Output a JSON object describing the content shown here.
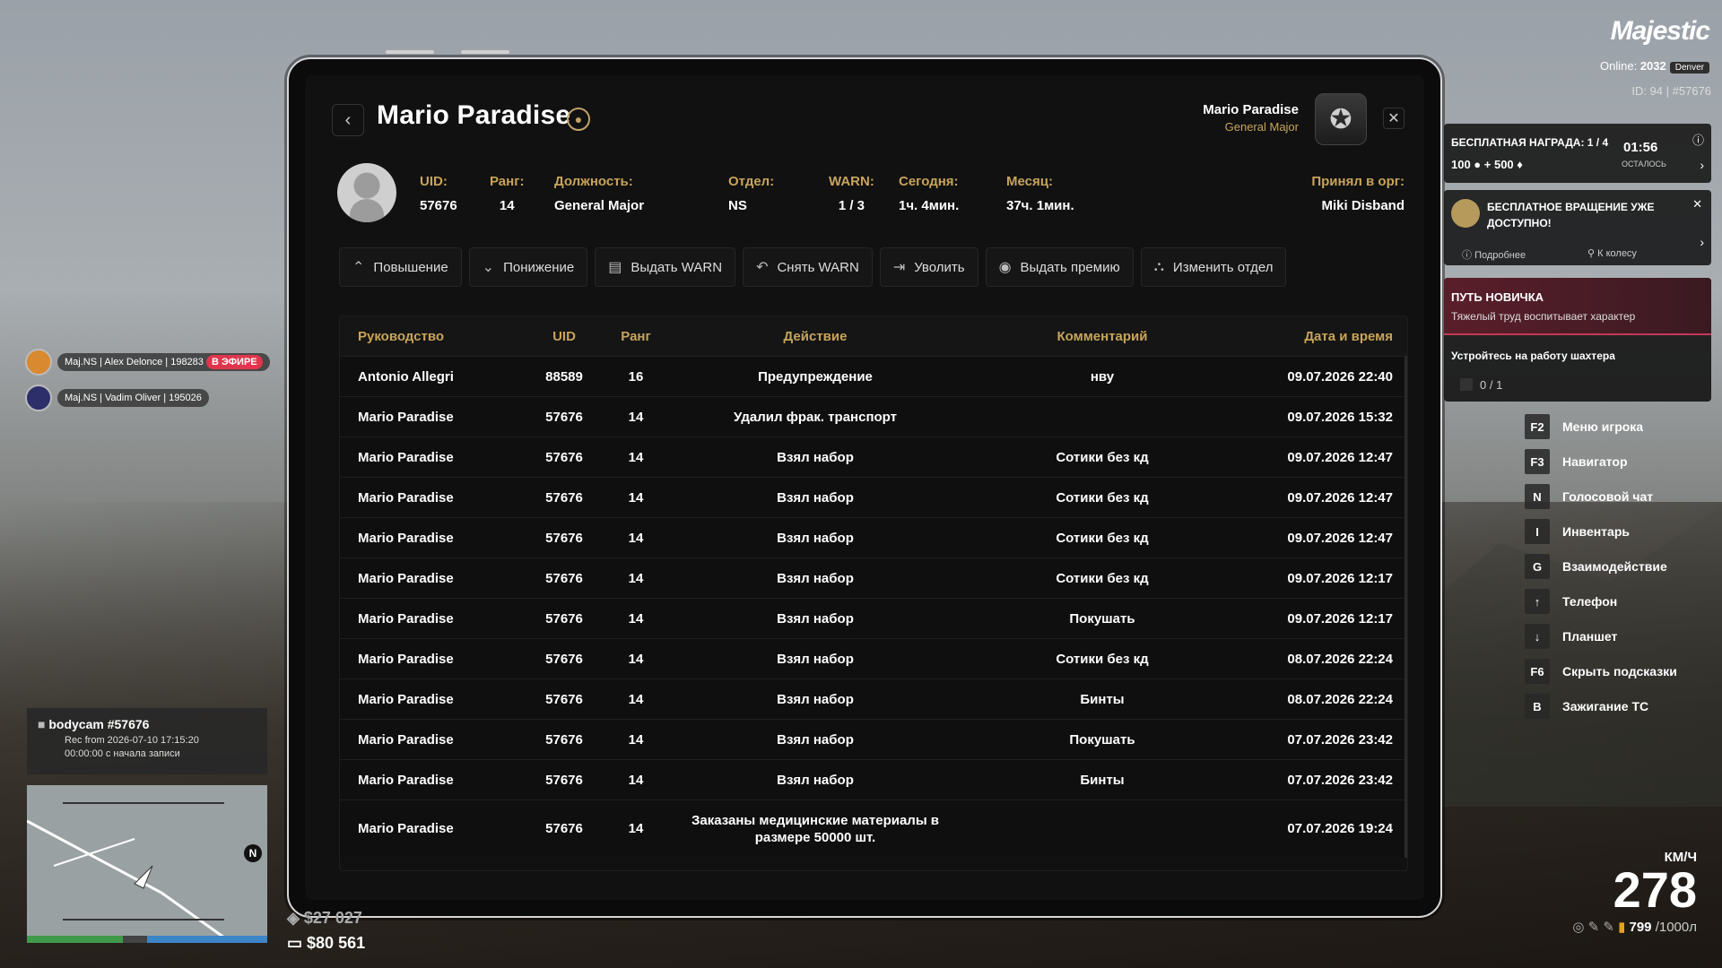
{
  "tablet": {
    "title": "Mario Paradise",
    "user_name": "Mario Paradise",
    "user_rank": "General Major",
    "info": [
      {
        "label": "UID:",
        "value": "57676"
      },
      {
        "label": "Ранг:",
        "value": "14"
      },
      {
        "label": "Должность:",
        "value": "General Major"
      },
      {
        "label": "Отдел:",
        "value": "NS"
      },
      {
        "label": "WARN:",
        "value": "1 / 3"
      },
      {
        "label": "Сегодня:",
        "value": "1ч. 4мин."
      },
      {
        "label": "Месяц:",
        "value": "37ч. 1мин."
      },
      {
        "label": "Принял в орг:",
        "value": "Miki Disband"
      }
    ],
    "actions": [
      {
        "label": "Повышение",
        "icon": "chevron-up-icon"
      },
      {
        "label": "Понижение",
        "icon": "chevron-down-icon"
      },
      {
        "label": "Выдать WARN",
        "icon": "document-icon"
      },
      {
        "label": "Снять WARN",
        "icon": "undo-icon"
      },
      {
        "label": "Уволить",
        "icon": "person-exit-icon"
      },
      {
        "label": "Выдать премию",
        "icon": "coin-icon"
      },
      {
        "label": "Изменить отдел",
        "icon": "hierarchy-icon"
      }
    ],
    "table": {
      "headers": [
        "Руководство",
        "UID",
        "Ранг",
        "Действие",
        "Комментарий",
        "Дата и время"
      ],
      "rows": [
        [
          "Antonio Allegri",
          "88589",
          "16",
          "Предупреждение",
          "нву",
          "09.07.2026 22:40"
        ],
        [
          "Mario Paradise",
          "57676",
          "14",
          "Удалил фрак. транспорт",
          "",
          "09.07.2026 15:32"
        ],
        [
          "Mario Paradise",
          "57676",
          "14",
          "Взял набор",
          "Сотики без кд",
          "09.07.2026 12:47"
        ],
        [
          "Mario Paradise",
          "57676",
          "14",
          "Взял набор",
          "Сотики без кд",
          "09.07.2026 12:47"
        ],
        [
          "Mario Paradise",
          "57676",
          "14",
          "Взял набор",
          "Сотики без кд",
          "09.07.2026 12:47"
        ],
        [
          "Mario Paradise",
          "57676",
          "14",
          "Взял набор",
          "Сотики без кд",
          "09.07.2026 12:17"
        ],
        [
          "Mario Paradise",
          "57676",
          "14",
          "Взял набор",
          "Покушать",
          "09.07.2026 12:17"
        ],
        [
          "Mario Paradise",
          "57676",
          "14",
          "Взял набор",
          "Сотики без кд",
          "08.07.2026 22:24"
        ],
        [
          "Mario Paradise",
          "57676",
          "14",
          "Взял набор",
          "Бинты",
          "08.07.2026 22:24"
        ],
        [
          "Mario Paradise",
          "57676",
          "14",
          "Взял набор",
          "Покушать",
          "07.07.2026 23:42"
        ],
        [
          "Mario Paradise",
          "57676",
          "14",
          "Взял набор",
          "Бинты",
          "07.07.2026 23:42"
        ],
        [
          "Mario Paradise",
          "57676",
          "14",
          "Заказаны медицинские материалы в размере 50000 шт.",
          "",
          "07.07.2026 19:24"
        ]
      ]
    }
  },
  "hud": {
    "logo": "Majestic",
    "online_label": "Online:",
    "online_count": "2032",
    "server": "Denver",
    "id_text": "ID: 94 | #57676",
    "reward_title": "БЕСПЛАТНАЯ НАГРАДА: 1 / 4",
    "reward_values": "100 ● + 500 ♦",
    "reward_time": "01:56",
    "reward_time_label": "ОСТАЛОСЬ",
    "spin_title": "БЕСПЛАТНОЕ ВРАЩЕНИЕ УЖЕ ДОСТУПНО!",
    "spin_more": "Подробнее",
    "spin_wheel": "К колесу",
    "quest_title": "ПУТЬ НОВИЧКА",
    "quest_sub": "Тяжелый труд воспитывает характер",
    "quest_task": "Устройтесь на работу шахтера",
    "quest_progress": "0 / 1",
    "keys": [
      {
        "key": "F2",
        "label": "Меню игрока"
      },
      {
        "key": "F3",
        "label": "Навигатор"
      },
      {
        "key": "N",
        "label": "Голосовой чат"
      },
      {
        "key": "I",
        "label": "Инвентарь"
      },
      {
        "key": "G",
        "label": "Взаимодействие"
      },
      {
        "key": "↑",
        "label": "Телефон"
      },
      {
        "key": "↓",
        "label": "Планшет"
      },
      {
        "key": "F6",
        "label": "Скрыть подсказки"
      },
      {
        "key": "B",
        "label": "Зажигание ТС"
      }
    ],
    "speed_unit": "КМ/Ч",
    "speed": "278",
    "fuel": "799",
    "fuel_max": "/1000л",
    "voice": [
      {
        "text": "Maj.NS | Alex Delonce | 198283",
        "live": "В ЭФИРЕ"
      },
      {
        "text": "Maj.NS | Vadim Oliver | 195026"
      }
    ],
    "bodycam_title": "bodycam #57676",
    "bodycam_rec": "Rec from 2026-07-10 17:15:20",
    "bodycam_time": "00:00:00 с начала записи",
    "money_cash": "$27 027",
    "money_bank": "$80 561",
    "compass": "N"
  }
}
